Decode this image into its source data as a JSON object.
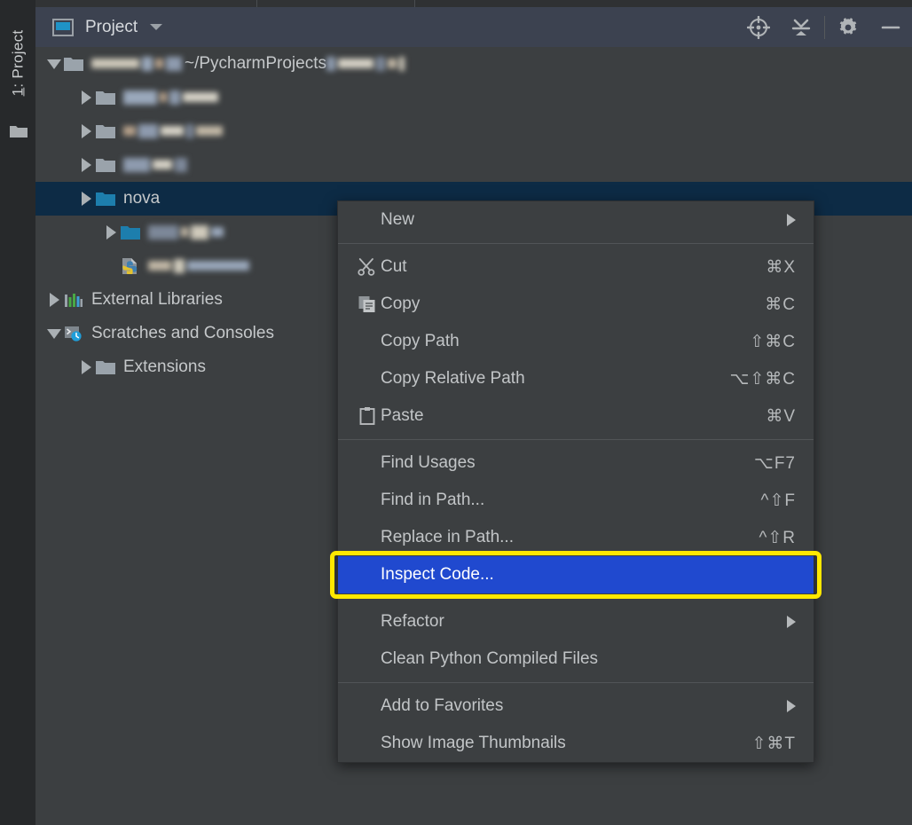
{
  "window": {
    "tool_window_tab": "1: Project",
    "tool_window_tab_number": "1",
    "tool_window_tab_rest": ": Project"
  },
  "panel": {
    "title": "Project",
    "icon": "project-window-icon",
    "dropdown_icon": "chevron-down-icon",
    "tools": [
      {
        "name": "locate-target-icon",
        "label": "Select Opened File"
      },
      {
        "name": "collapse-all-icon",
        "label": "Collapse All"
      },
      {
        "name": "gear-icon",
        "label": "Settings"
      },
      {
        "name": "minimize-icon",
        "label": "Hide"
      }
    ]
  },
  "tree": {
    "rows": [
      {
        "name": "project-root",
        "indent": 10,
        "twisty": "down",
        "icon": "folder",
        "redacted_label": true,
        "redacted_widths": [
          54,
          12,
          9,
          18
        ],
        "label": "~/PycharmProjects",
        "label_suffix_redacted": true,
        "suffix_widths": [
          10,
          40,
          10,
          10,
          6
        ],
        "selected": false
      },
      {
        "name": "folder-redacted-1",
        "indent": 46,
        "twisty": "right",
        "icon": "folder",
        "redacted_label": true,
        "redacted_widths": [
          38,
          8,
          12,
          40
        ],
        "selected": false
      },
      {
        "name": "folder-redacted-2",
        "indent": 46,
        "twisty": "right",
        "icon": "folder",
        "redacted_label": true,
        "redacted_widths": [
          14,
          22,
          26,
          8,
          30
        ],
        "selected": false
      },
      {
        "name": "folder-redacted-3",
        "indent": 46,
        "twisty": "right",
        "icon": "folder",
        "redacted_label": true,
        "redacted_widths": [
          30,
          22,
          14
        ],
        "selected": false
      },
      {
        "name": "folder-nova",
        "indent": 46,
        "twisty": "right",
        "icon": "folder-blue",
        "label": "nova",
        "selected": true
      },
      {
        "name": "folder-redacted-4",
        "indent": 74,
        "twisty": "right",
        "icon": "folder-blue",
        "redacted_label": true,
        "redacted_widths": [
          34,
          8,
          20,
          14
        ],
        "selected": false
      },
      {
        "name": "python-file-redacted",
        "indent": 74,
        "twisty": "none",
        "icon": "python-file",
        "redacted_label": true,
        "redacted_widths": [
          26,
          12,
          70
        ],
        "selected": false
      },
      {
        "name": "external-libraries",
        "indent": 10,
        "twisty": "right",
        "icon": "libraries",
        "label": "External Libraries",
        "selected": false
      },
      {
        "name": "scratches-and-consoles",
        "indent": 10,
        "twisty": "down",
        "icon": "scratches",
        "label": "Scratches and Consoles",
        "selected": false
      },
      {
        "name": "extensions",
        "indent": 46,
        "twisty": "right",
        "icon": "folder",
        "label": "Extensions",
        "selected": false
      }
    ]
  },
  "context_menu": {
    "groups": [
      {
        "items": [
          {
            "name": "menu-item-new",
            "label": "New",
            "shortcut": "",
            "icon": "",
            "submenu": true,
            "highlighted": false
          }
        ]
      },
      {
        "items": [
          {
            "name": "menu-item-cut",
            "label": "Cut",
            "shortcut": "⌘X",
            "icon": "scissors-icon",
            "submenu": false,
            "highlighted": false
          },
          {
            "name": "menu-item-copy",
            "label": "Copy",
            "shortcut": "⌘C",
            "icon": "copy-icon",
            "submenu": false,
            "highlighted": false
          },
          {
            "name": "menu-item-copy-path",
            "label": "Copy Path",
            "shortcut": "⇧⌘C",
            "icon": "",
            "submenu": false,
            "highlighted": false
          },
          {
            "name": "menu-item-copy-relative-path",
            "label": "Copy Relative Path",
            "shortcut": "⌥⇧⌘C",
            "icon": "",
            "submenu": false,
            "highlighted": false
          },
          {
            "name": "menu-item-paste",
            "label": "Paste",
            "shortcut": "⌘V",
            "icon": "clipboard-icon",
            "submenu": false,
            "highlighted": false
          }
        ]
      },
      {
        "items": [
          {
            "name": "menu-item-find-usages",
            "label": "Find Usages",
            "shortcut": "⌥F7",
            "icon": "",
            "submenu": false,
            "highlighted": false
          },
          {
            "name": "menu-item-find-in-path",
            "label": "Find in Path...",
            "shortcut": "^⇧F",
            "icon": "",
            "submenu": false,
            "highlighted": false
          },
          {
            "name": "menu-item-replace-in-path",
            "label": "Replace in Path...",
            "shortcut": "^⇧R",
            "icon": "",
            "submenu": false,
            "highlighted": false
          },
          {
            "name": "menu-item-inspect-code",
            "label": "Inspect Code...",
            "shortcut": "",
            "icon": "",
            "submenu": false,
            "highlighted": true
          }
        ]
      },
      {
        "items": [
          {
            "name": "menu-item-refactor",
            "label": "Refactor",
            "shortcut": "",
            "icon": "",
            "submenu": true,
            "highlighted": false
          },
          {
            "name": "menu-item-clean-python-compiled-files",
            "label": "Clean Python Compiled Files",
            "shortcut": "",
            "icon": "",
            "submenu": false,
            "highlighted": false
          }
        ]
      },
      {
        "items": [
          {
            "name": "menu-item-add-to-favorites",
            "label": "Add to Favorites",
            "shortcut": "",
            "icon": "",
            "submenu": true,
            "highlighted": false
          },
          {
            "name": "menu-item-show-image-thumbnails",
            "label": "Show Image Thumbnails",
            "shortcut": "⇧⌘T",
            "icon": "",
            "submenu": false,
            "highlighted": false
          }
        ]
      }
    ]
  },
  "colors": {
    "panel_background": "#3c3f41",
    "header_background": "#3c4250",
    "selection_navy": "#0d2b45",
    "highlight_blue": "#2049cf",
    "annotation_yellow": "#ffe800",
    "folder_blue": "#1d7ead",
    "text": "#c5c8ca"
  }
}
